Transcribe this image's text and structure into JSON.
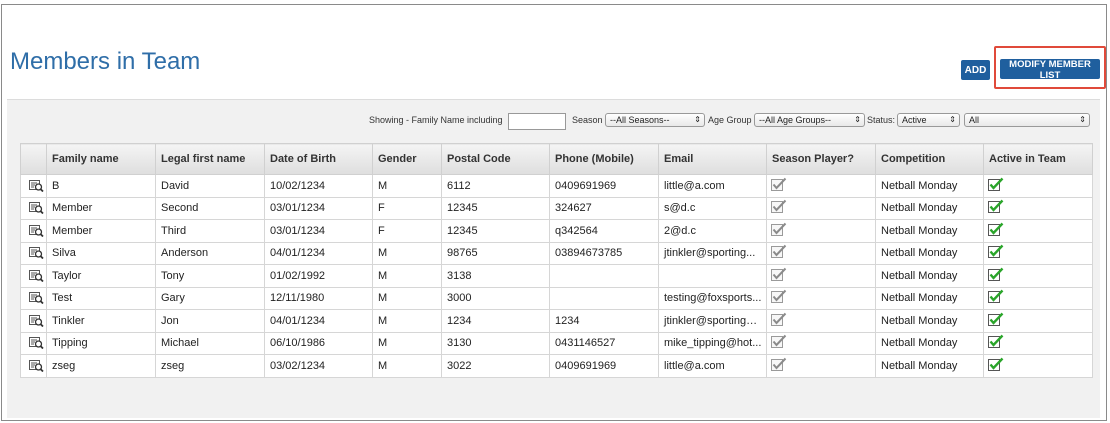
{
  "page": {
    "title": "Members in Team",
    "add_label": "ADD",
    "modify_label": "MODIFY MEMBER LIST"
  },
  "filters": {
    "showing_label": "Showing - Family Name including",
    "family_name_value": "",
    "season_label": "Season",
    "season_value": "--All Seasons--",
    "age_group_label": "Age Group",
    "age_group_value": "--All Age Groups--",
    "status_label": "Status:",
    "status_value": "Active",
    "extra_value": "All"
  },
  "table": {
    "columns": [
      "Family name",
      "Legal first name",
      "Date of Birth",
      "Gender",
      "Postal Code",
      "Phone (Mobile)",
      "Email",
      "Season Player?",
      "Competition",
      "Active in Team"
    ],
    "rows": [
      {
        "family": "B",
        "first": "David",
        "dob": "10/02/1234",
        "gender": "M",
        "postal": "6112",
        "phone": "0409691969",
        "email": "little@a.com",
        "competition": "Netball Monday"
      },
      {
        "family": "Member",
        "first": "Second",
        "dob": "03/01/1234",
        "gender": "F",
        "postal": "12345",
        "phone": "324627",
        "email": "s@d.c",
        "competition": "Netball Monday"
      },
      {
        "family": "Member",
        "first": "Third",
        "dob": "03/01/1234",
        "gender": "F",
        "postal": "12345",
        "phone": "q342564",
        "email": "2@d.c",
        "competition": "Netball Monday"
      },
      {
        "family": "Silva",
        "first": "Anderson",
        "dob": "04/01/1234",
        "gender": "M",
        "postal": "98765",
        "phone": "03894673785",
        "email": "jtinkler@sporting...",
        "competition": "Netball Monday"
      },
      {
        "family": "Taylor",
        "first": "Tony",
        "dob": "01/02/1992",
        "gender": "M",
        "postal": "3138",
        "phone": "",
        "email": "",
        "competition": "Netball Monday"
      },
      {
        "family": "Test",
        "first": "Gary",
        "dob": "12/11/1980",
        "gender": "M",
        "postal": "3000",
        "phone": "",
        "email": "testing@foxsports...",
        "competition": "Netball Monday"
      },
      {
        "family": "Tinkler",
        "first": "Jon",
        "dob": "04/01/1234",
        "gender": "M",
        "postal": "1234",
        "phone": "1234",
        "email": "jtinkler@sporting@hot...",
        "competition": "Netball Monday"
      },
      {
        "family": "Tipping",
        "first": "Michael",
        "dob": "06/10/1986",
        "gender": "M",
        "postal": "3130",
        "phone": "0431146527",
        "email": "mike_tipping@hot...",
        "competition": "Netball Monday"
      },
      {
        "family": "zseg",
        "first": "zseg",
        "dob": "03/02/1234",
        "gender": "M",
        "postal": "3022",
        "phone": "0409691969",
        "email": "little@a.com",
        "competition": "Netball Monday"
      }
    ]
  },
  "colors": {
    "accent": "#1f5f9e",
    "title": "#2f6ea8",
    "highlight": "#e04a3a",
    "active_check": "#2aa52a"
  },
  "icons": {
    "row_action": "view-record-icon",
    "season_player": "checkbox-checked-grey-icon",
    "active_in_team": "checkbox-checked-green-icon"
  }
}
